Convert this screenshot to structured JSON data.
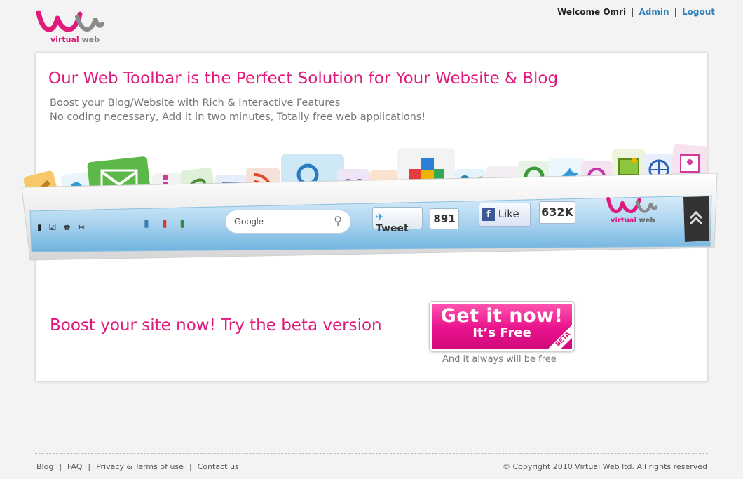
{
  "logo": {
    "brand_virtual": "virtual",
    "brand_web": "web"
  },
  "header": {
    "welcome": "Welcome Omri",
    "admin_label": "Admin",
    "logout_label": "Logout"
  },
  "main": {
    "headline": "Our Web Toolbar is the Perfect Solution for Your Website & Blog",
    "sub1": "Boost your Blog/Website with Rich & Interactive Features",
    "sub2": "No coding necessary, Add it in two minutes, Totally free web applications!",
    "toolbar_demo": {
      "search_placeholder": "Google",
      "tweet_label": "Tweet",
      "tweet_count": "891",
      "like_label": "Like",
      "like_count": "632K",
      "brand_virtual": "virtual",
      "brand_web": "web",
      "feature_icons": [
        "edit-icon",
        "twitter-add-icon",
        "mail-icon",
        "info-icon",
        "link-icon",
        "list-icon",
        "rss-icon",
        "search-icon",
        "group-icon",
        "html-icon",
        "puzzle-icon",
        "people-icon",
        "stumbleupon-icon",
        "refresh-icon",
        "twitter-icon",
        "share-icon",
        "photo-icon",
        "globe-icon",
        "contact-card-icon"
      ],
      "bar_icons": [
        "mobile-icon",
        "checkbox-icon",
        "users-icon",
        "scissors-icon",
        "bookmark-icon",
        "youtube-icon",
        "refresh-icon"
      ]
    },
    "boost_text": "Boost your site now! Try the beta version",
    "cta": {
      "main": "Get it now!",
      "sub": "It’s Free",
      "badge": "BETA"
    },
    "cta_note": "And it always will be free"
  },
  "footer": {
    "links": [
      "Blog",
      "FAQ",
      "Privacy & Terms of use",
      "Contact us"
    ],
    "copyright": "© Copyright 2010 Virtual Web ltd.  All rights reserved"
  },
  "colors": {
    "brand_pink": "#e0197c",
    "link_blue": "#2e7fb8",
    "background": "#f3f3f3"
  }
}
